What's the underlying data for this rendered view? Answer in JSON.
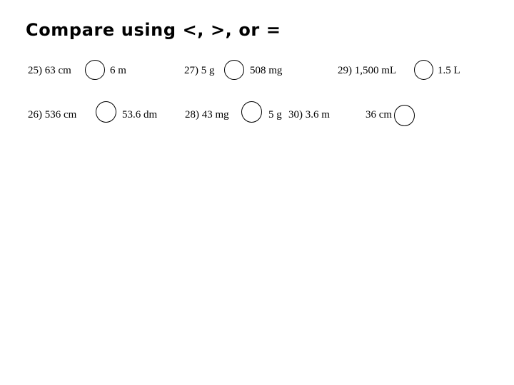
{
  "slide": {
    "title": "Compare using <, >, or =",
    "background_color": "#ffffff",
    "text_color": "#000000"
  },
  "problems": [
    {
      "number": "25)",
      "left_value": "63 cm",
      "right_value": "6 m",
      "comparison_blank": "circle",
      "full_text": "25) 63 cm        6 m"
    },
    {
      "number": "26)",
      "left_value": "536 cm",
      "right_value": "53.6 dm",
      "comparison_blank": "circle",
      "full_text": "26) 536 cm         53.6 dm"
    },
    {
      "number": "27)",
      "left_value": "5 g",
      "right_value": "508 mg",
      "comparison_blank": "circle",
      "full_text": "27) 5 g        508 mg"
    },
    {
      "number": "28)",
      "left_value": "43 mg",
      "right_value": "5 g",
      "comparison_blank": "circle",
      "full_text": "28) 43 mg        5 g"
    },
    {
      "number": "29)",
      "left_value": "1,500 mL",
      "right_value": "1.5 L",
      "comparison_blank": "circle",
      "full_text": "29) 1,500 mL        1.5 L"
    },
    {
      "number": "30)",
      "left_value": "3.6 m",
      "right_value": "36 cm",
      "comparison_blank": "circle",
      "full_text": "30) 3.6 m      36 cm"
    }
  ],
  "segments": {
    "p25_left": "25) 63 cm",
    "p25_right": "6 m",
    "p26_left": "26) 536 cm",
    "p26_right": "53.6 dm",
    "p27_left": "27) 5 g",
    "p27_right": "508 mg",
    "p28_left": "28) 43 mg",
    "p28_right": "5 g",
    "p29_left": "29) 1,500 mL",
    "p29_right": "1.5 L",
    "p30_left": "30) 3.6 m",
    "p30_right": "36 cm"
  }
}
